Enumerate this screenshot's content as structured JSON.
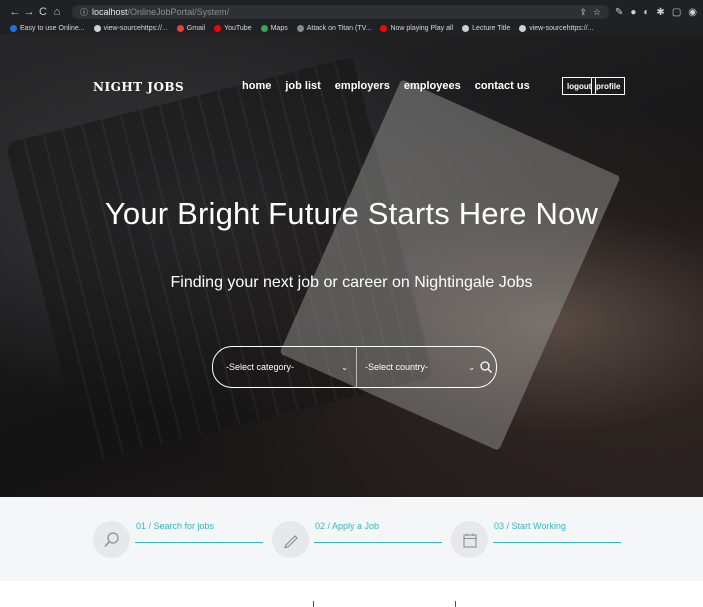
{
  "browser": {
    "nav": {
      "back": "←",
      "forward": "→",
      "reload": "C",
      "home": "⌂"
    },
    "address": {
      "host": "localhost",
      "path": "/OnlineJobPortal/System/"
    },
    "bookmarks": [
      {
        "label": "Easy to use Online...",
        "color": "#1a73e8"
      },
      {
        "label": "view-sourcehttps://...",
        "color": "#cfcfcf"
      },
      {
        "label": "Gmail",
        "color": "#ea4335"
      },
      {
        "label": "YouTube",
        "color": "#ff0000"
      },
      {
        "label": "Maps",
        "color": "#34a853"
      },
      {
        "label": "Attack on Titan (TV...",
        "color": "#8a8a8a"
      },
      {
        "label": "Now playing Play all",
        "color": "#ff0000"
      },
      {
        "label": "Lecture Title",
        "color": "#cfcfcf"
      },
      {
        "label": "view-sourcehttps://...",
        "color": "#cfcfcf"
      }
    ]
  },
  "header": {
    "logo": "NIGHT JOBS",
    "nav": [
      "home",
      "job list",
      "employers",
      "employees",
      "contact us"
    ],
    "logout": "logout",
    "profile": "profile"
  },
  "hero": {
    "headline": "Your Bright Future Starts Here Now",
    "subline": "Finding your next job or career on Nightingale Jobs",
    "category_select": "-Select category-",
    "country_select": "-Select country-"
  },
  "steps": [
    {
      "label": "01 / Search for jobs",
      "icon": "magnifier-icon"
    },
    {
      "label": "02 / Apply a Job",
      "icon": "pencil-icon"
    },
    {
      "label": "03 / Start Working",
      "icon": "calendar-icon"
    }
  ],
  "colors": {
    "accent": "#36b8bf"
  }
}
